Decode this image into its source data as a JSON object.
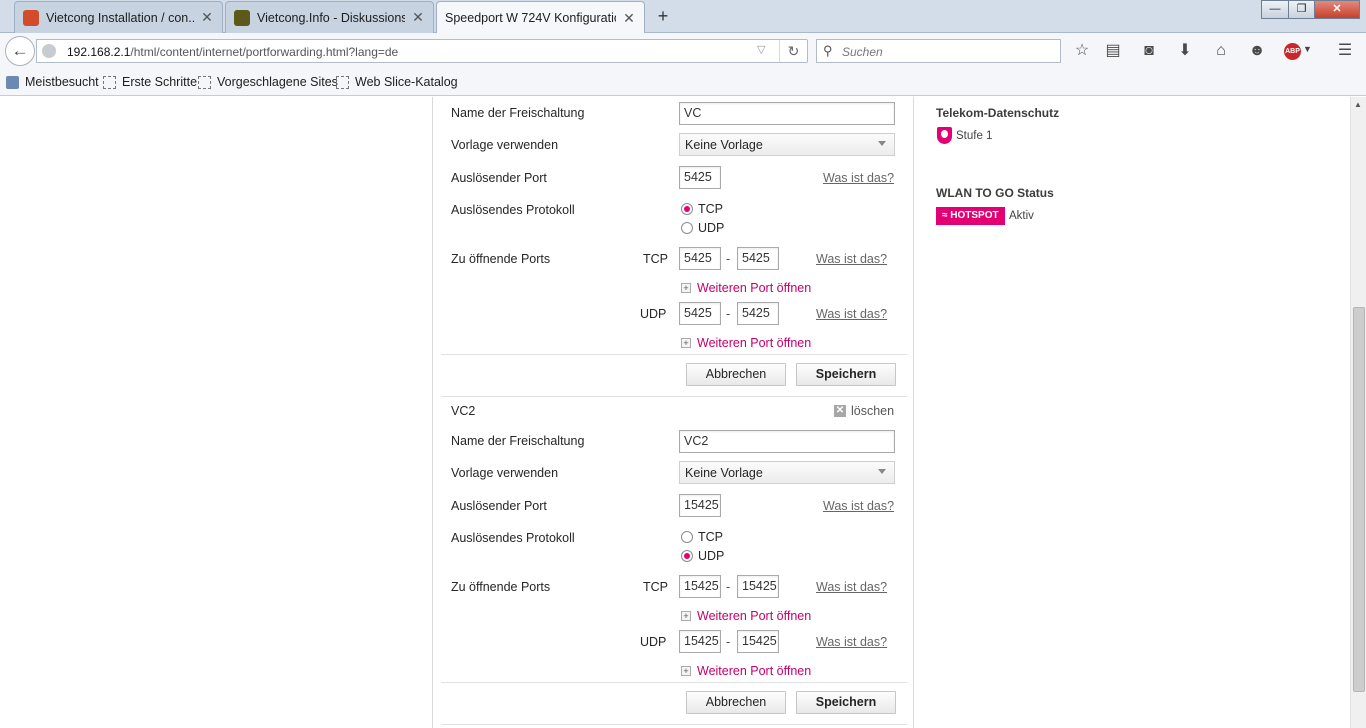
{
  "browser": {
    "tabs": [
      {
        "title": "Vietcong Installation / con...",
        "close": "✕",
        "favicon_color": "#d24b2a"
      },
      {
        "title": "Vietcong.Info - Diskussions...",
        "close": "✕",
        "favicon_color": "#5b5a1a"
      },
      {
        "title": "Speedport W 724V Konfiguratio...",
        "close": "✕",
        "favicon_color": "#e20074"
      }
    ],
    "new_tab": "+",
    "window": {
      "minimize": "—",
      "maximize": "❐",
      "close": "✕"
    },
    "url": {
      "host": "192.168.2.1",
      "path": "/html/content/internet/portforwarding.html?lang=de"
    },
    "search_placeholder": "Suchen",
    "toolbar_icons": {
      "bookmark": "☆",
      "reader": "▤",
      "pocket": "◙",
      "download": "⬇",
      "home": "⌂",
      "chat": "☻",
      "menu": "☰"
    },
    "abp": "ABP",
    "bookmarks": [
      "Meistbesucht",
      "Erste Schritte",
      "Vorgeschlagene Sites",
      "Web Slice-Katalog"
    ]
  },
  "rules": [
    {
      "name_label": "Name der Freischaltung",
      "name_value": "VC",
      "template_label": "Vorlage verwenden",
      "template_value": "Keine Vorlage",
      "trigger_label": "Auslösender Port",
      "trigger_value": "5425",
      "help": "Was ist das?",
      "protocol_label": "Auslösendes Protokoll",
      "tcp": "TCP",
      "udp": "UDP",
      "protocol_selected": "TCP",
      "open_label": "Zu öffnende Ports",
      "tcp_from": "5425",
      "tcp_to": "5425",
      "udp_from": "5425",
      "udp_to": "5425",
      "more": "Weiteren Port öffnen",
      "cancel": "Abbrechen",
      "save": "Speichern"
    },
    {
      "title": "VC2",
      "delete": "löschen",
      "name_label": "Name der Freischaltung",
      "name_value": "VC2",
      "template_label": "Vorlage verwenden",
      "template_value": "Keine Vorlage",
      "trigger_label": "Auslösender Port",
      "trigger_value": "15425",
      "help": "Was ist das?",
      "protocol_label": "Auslösendes Protokoll",
      "tcp": "TCP",
      "udp": "UDP",
      "protocol_selected": "UDP",
      "open_label": "Zu öffnende Ports",
      "tcp_from": "15425",
      "tcp_to": "15425",
      "udp_from": "15425",
      "udp_to": "15425",
      "more": "Weiteren Port öffnen",
      "cancel": "Abbrechen",
      "save": "Speichern"
    }
  ],
  "sidebar": {
    "privacy_heading": "Telekom-Datenschutz",
    "privacy_level": "Stufe 1",
    "wlan_heading": "WLAN TO GO Status",
    "hotspot_badge": "HOTSPOT",
    "hotspot_status": "Aktiv"
  },
  "colors": {
    "accent": "#e20074",
    "link": "#c5006a"
  }
}
